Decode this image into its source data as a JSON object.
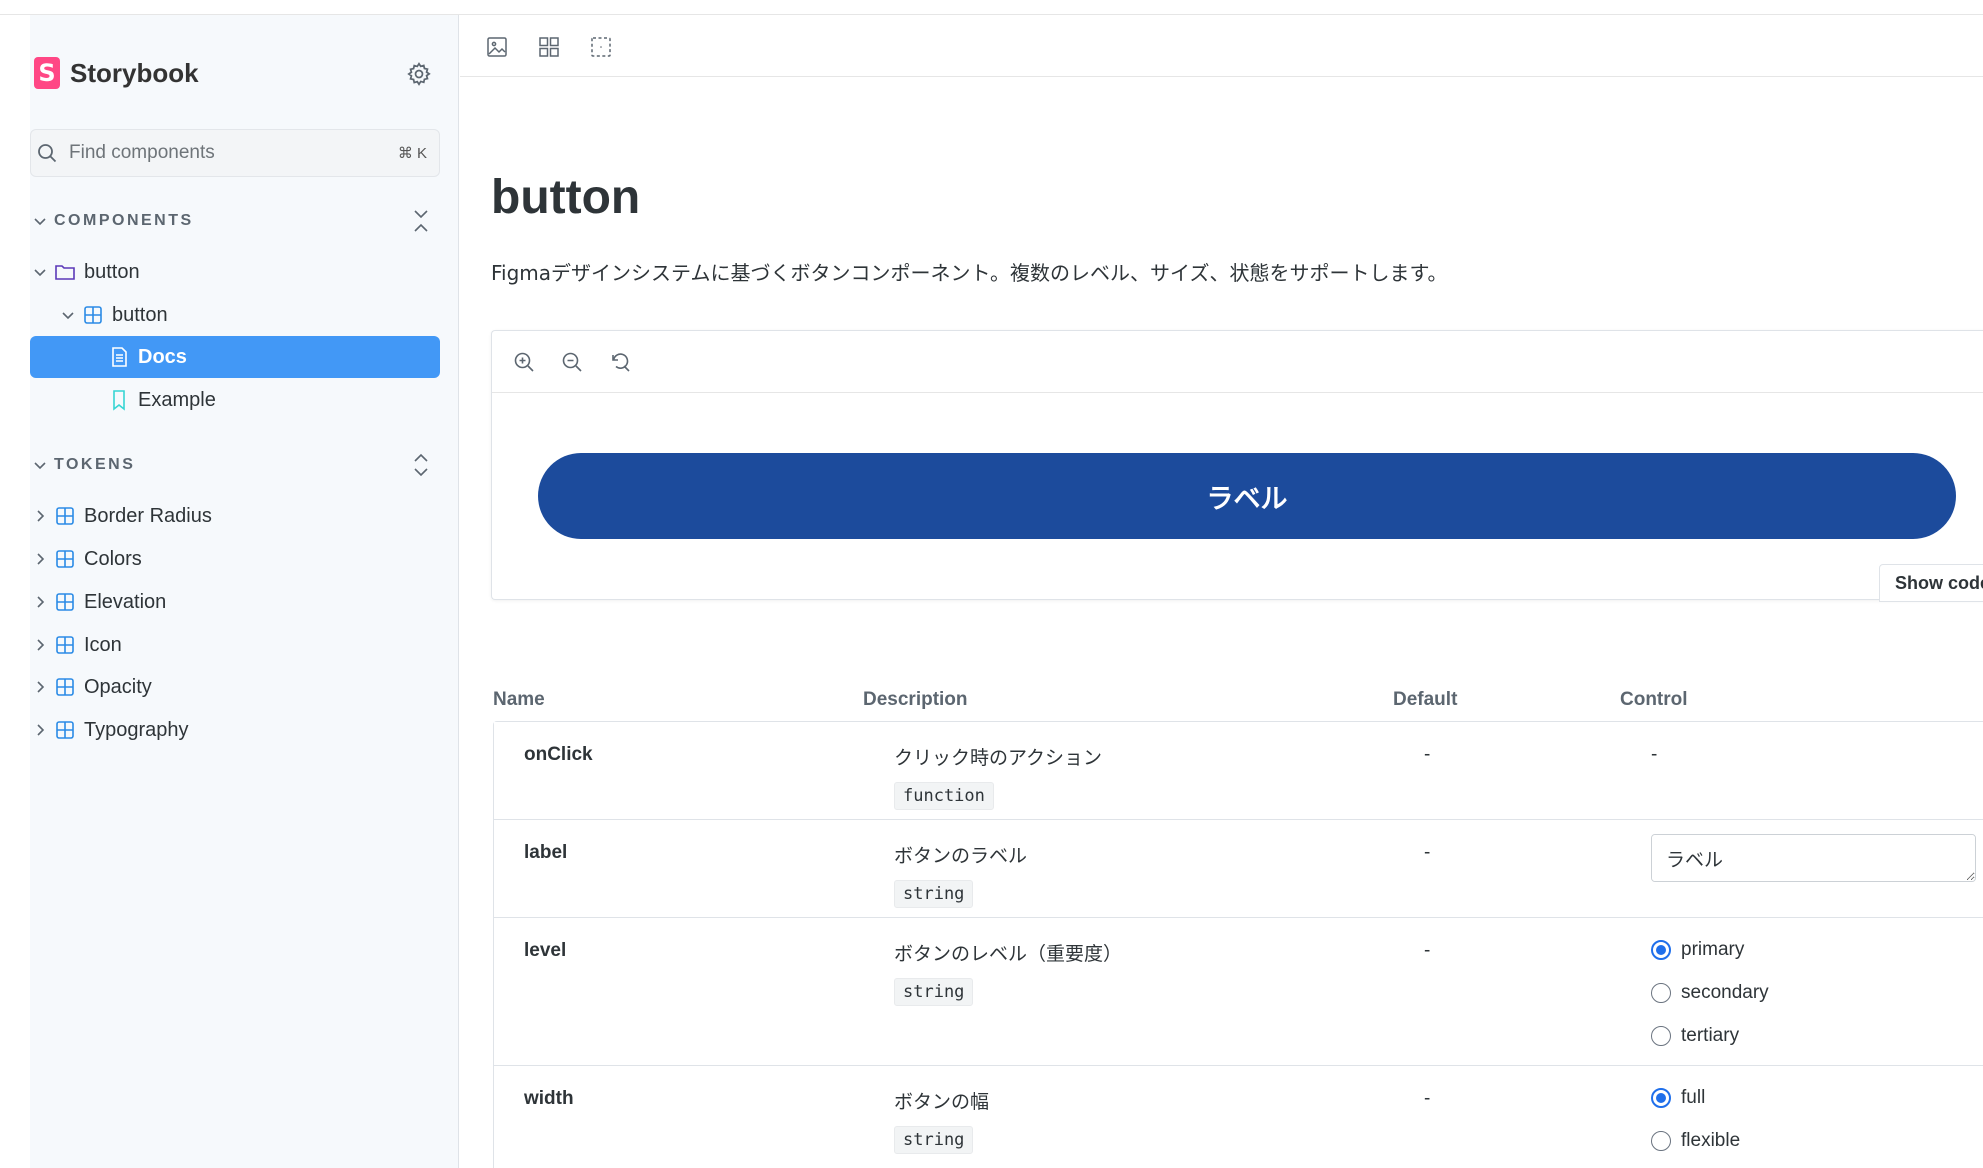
{
  "sidebar": {
    "brand_letter": "S",
    "brand_name": "Storybook",
    "search": {
      "placeholder": "Find components",
      "shortcut": "⌘ K"
    },
    "sections": [
      {
        "label": "COMPONENTS"
      },
      {
        "label": "TOKENS"
      }
    ],
    "components": {
      "group": "button",
      "component": "button",
      "docs": "Docs",
      "story": "Example"
    },
    "tokens": [
      "Border Radius",
      "Colors",
      "Elevation",
      "Icon",
      "Opacity",
      "Typography"
    ]
  },
  "doc": {
    "title": "button",
    "description": "Figmaデザインシステムに基づくボタンコンポーネント。複数のレベル、サイズ、状態をサポートします。",
    "preview_button_label": "ラベル",
    "show_code": "Show code"
  },
  "args_table": {
    "headers": {
      "name": "Name",
      "description": "Description",
      "default": "Default",
      "control": "Control"
    },
    "rows": [
      {
        "name": "onClick",
        "description": "クリック時のアクション",
        "type": "function",
        "default": "-",
        "control": "-"
      },
      {
        "name": "label",
        "description": "ボタンのラベル",
        "type": "string",
        "default": "-",
        "control_value": "ラベル"
      },
      {
        "name": "level",
        "description": "ボタンのレベル（重要度）",
        "type": "string",
        "default": "-",
        "options": [
          "primary",
          "secondary",
          "tertiary"
        ],
        "selected": "primary"
      },
      {
        "name": "width",
        "description": "ボタンの幅",
        "type": "string",
        "default": "-",
        "options": [
          "full",
          "flexible"
        ],
        "selected": "full"
      }
    ]
  },
  "colors": {
    "accent": "#4298f6",
    "button": "#1c4b9c",
    "brand": "#ff4785"
  }
}
